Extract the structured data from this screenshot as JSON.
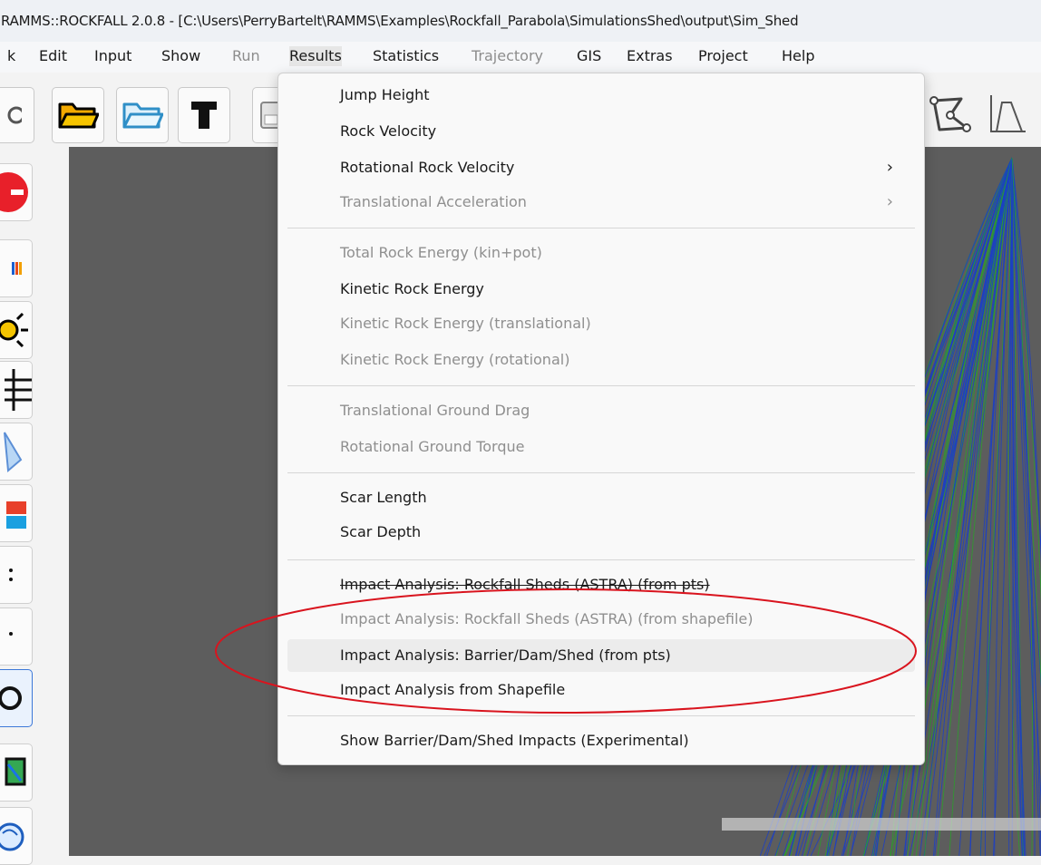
{
  "window": {
    "title": "RAMMS::ROCKFALL 2.0.8 - [C:\\Users\\PerryBartelt\\RAMMS\\Examples\\Rockfall_Parabola\\SimulationsShed\\output\\Sim_Shed"
  },
  "menubar": {
    "items": [
      {
        "label": "k",
        "disabled": false
      },
      {
        "label": "Edit",
        "disabled": false
      },
      {
        "label": "Input",
        "disabled": false
      },
      {
        "label": "Show",
        "disabled": false
      },
      {
        "label": "Run",
        "disabled": true
      },
      {
        "label": "Results",
        "disabled": false,
        "open": true
      },
      {
        "label": "Statistics",
        "disabled": false
      },
      {
        "label": "Trajectory",
        "disabled": true
      },
      {
        "label": "GIS",
        "disabled": false
      },
      {
        "label": "Extras",
        "disabled": false
      },
      {
        "label": "Project",
        "disabled": false
      },
      {
        "label": "Help",
        "disabled": false
      }
    ]
  },
  "results_menu": {
    "groups": [
      [
        {
          "label": "Jump Height",
          "disabled": false
        },
        {
          "label": "Rock Velocity",
          "disabled": false
        },
        {
          "label": "Rotational Rock Velocity",
          "disabled": false,
          "submenu": true
        },
        {
          "label": "Translational Acceleration",
          "disabled": true,
          "submenu": true
        }
      ],
      [
        {
          "label": "Total Rock Energy (kin+pot)",
          "disabled": true
        },
        {
          "label": "Kinetic Rock Energy",
          "disabled": false
        },
        {
          "label": "Kinetic Rock Energy (translational)",
          "disabled": true
        },
        {
          "label": "Kinetic Rock Energy (rotational)",
          "disabled": true
        }
      ],
      [
        {
          "label": "Translational Ground Drag",
          "disabled": true
        },
        {
          "label": "Rotational Ground Torque",
          "disabled": true
        }
      ],
      [
        {
          "label": "Scar Length",
          "disabled": false
        },
        {
          "label": "Scar Depth",
          "disabled": false
        }
      ],
      [
        {
          "label": "Impact Analysis: Rockfall Sheds (ASTRA) (from pts)",
          "disabled": false,
          "strike": true
        },
        {
          "label": "Impact Analysis: Rockfall Sheds (ASTRA) (from shapefile)",
          "disabled": true
        },
        {
          "label": "Impact Analysis: Barrier/Dam/Shed (from pts)",
          "disabled": false,
          "highlighted": true
        },
        {
          "label": "Impact Analysis from Shapefile",
          "disabled": false
        }
      ],
      [
        {
          "label": "Show Barrier/Dam/Shed Impacts (Experimental)",
          "disabled": false
        }
      ]
    ],
    "submenu_arrow": "›"
  },
  "toolbar": {
    "buttons": [
      {
        "name": "settings-gear-icon"
      },
      {
        "name": "open-folder-icon"
      },
      {
        "name": "open-folder-outline-icon"
      },
      {
        "name": "text-tool-icon"
      },
      {
        "name": "save-disk-icon"
      },
      {
        "name": "polyline-tool-icon"
      },
      {
        "name": "profile-plot-icon"
      }
    ]
  },
  "sidebar": {
    "buttons": [
      {
        "name": "red-record-icon"
      },
      {
        "name": "color-bars-icon"
      },
      {
        "name": "sun-icon"
      },
      {
        "name": "grid-lines-icon"
      },
      {
        "name": "shape-icon"
      },
      {
        "name": "layers-icon"
      },
      {
        "name": "dots-icon"
      },
      {
        "name": "dot-icon"
      },
      {
        "name": "pin-icon"
      },
      {
        "name": "map-icon"
      },
      {
        "name": "globe-icon"
      }
    ]
  },
  "colors": {
    "annotation_ellipse": "#d9141e",
    "menu_bg": "#f9f9f9",
    "disabled_text": "#8f8f8f",
    "viewport_bg": "#5d5d5d",
    "trajectory_blue": "#1a3ec8",
    "trajectory_green": "#2aa02a"
  }
}
